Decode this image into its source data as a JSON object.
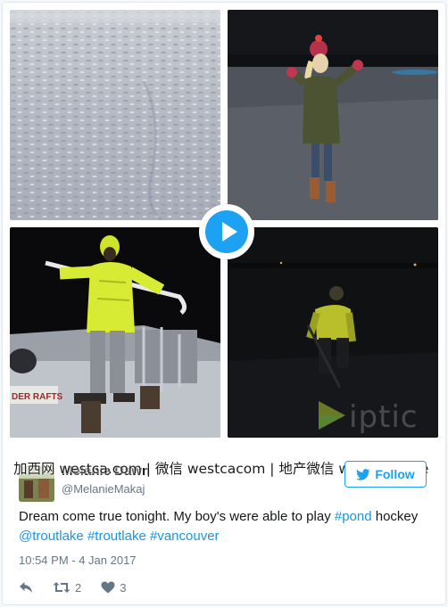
{
  "tweet": {
    "author_name": "Melanie Dawn",
    "author_handle": "@MelanieMakaj",
    "follow_label": "Follow",
    "text_parts": [
      {
        "text": "Dream come true tonight. My boy's were able to play ",
        "link": false
      },
      {
        "text": "#pond",
        "link": true
      },
      {
        "text": " hockey ",
        "link": false
      },
      {
        "text": "@troutlake",
        "link": true
      },
      {
        "text": " ",
        "link": false
      },
      {
        "text": "#troutlake",
        "link": true
      },
      {
        "text": " ",
        "link": false
      },
      {
        "text": "#vancouver",
        "link": true
      }
    ],
    "timestamp": "10:54 PM - 4 Jan 2017",
    "retweets": "2",
    "likes": "3"
  },
  "watermark": "加西网 westca.com | 微信 westcacom | 地产微信 westcahouse",
  "media": {
    "sign_text": "DER RAFTS",
    "app_watermark": "iptic"
  },
  "icons": {
    "play": "play-icon",
    "reply": "reply-icon",
    "retweet": "retweet-icon",
    "like": "heart-icon",
    "follow": "follow-bird-icon"
  },
  "colors": {
    "accent": "#1da1f2",
    "link": "#1b95e0",
    "muted": "#657786"
  }
}
